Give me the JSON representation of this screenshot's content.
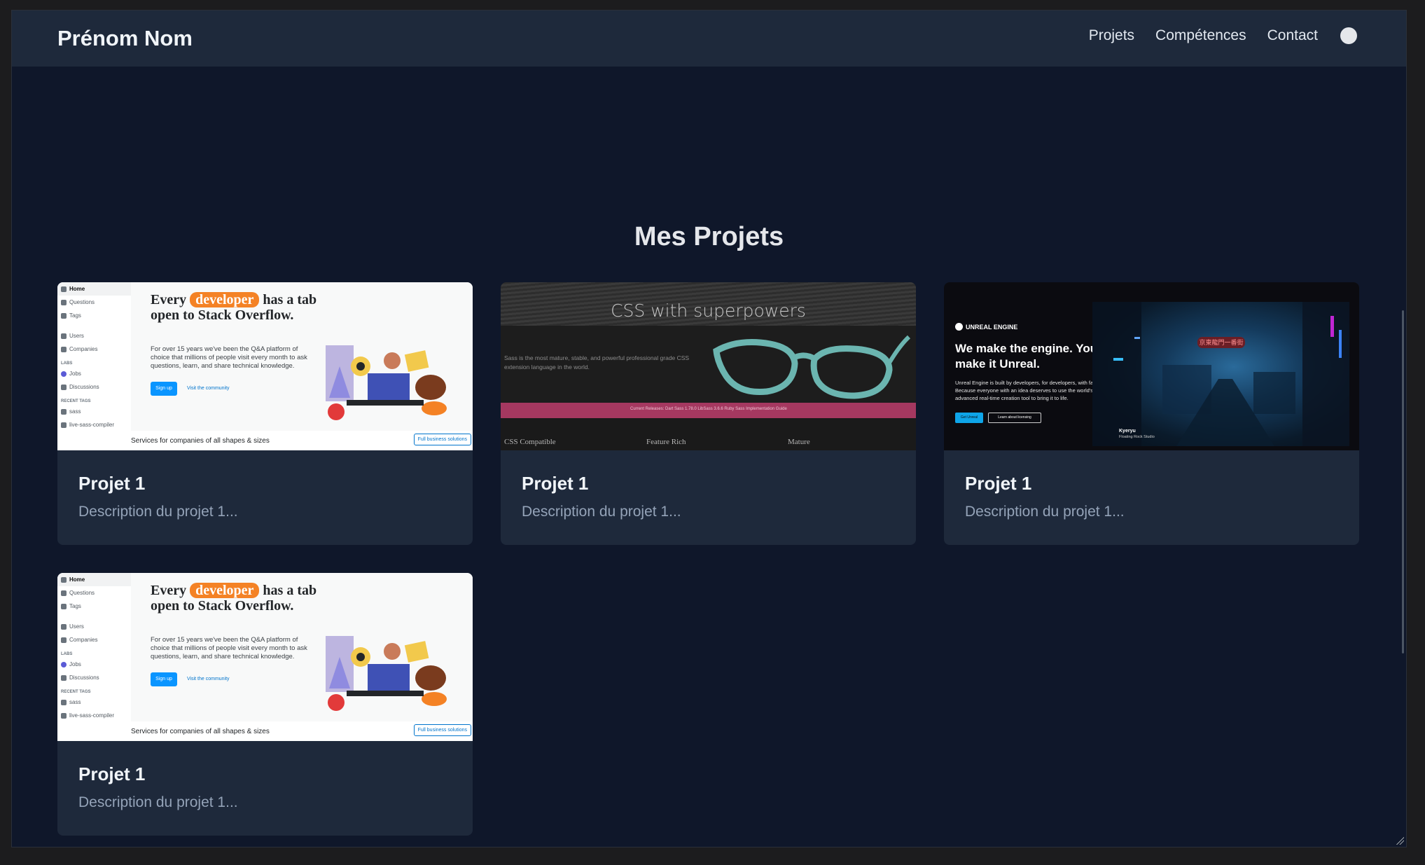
{
  "header": {
    "brand": "Prénom Nom",
    "nav": [
      "Projets",
      "Compétences",
      "Contact"
    ]
  },
  "section": {
    "title": "Mes Projets"
  },
  "projects": [
    {
      "title": "Projet 1",
      "description": "Description du projet 1...",
      "thumbnail": "stackoverflow"
    },
    {
      "title": "Projet 1",
      "description": "Description du projet 1...",
      "thumbnail": "sass"
    },
    {
      "title": "Projet 1",
      "description": "Description du projet 1...",
      "thumbnail": "unreal"
    },
    {
      "title": "Projet 1",
      "description": "Description du projet 1...",
      "thumbnail": "stackoverflow"
    }
  ],
  "thumbs": {
    "so": {
      "sidebar": [
        "Home",
        "Questions",
        "Tags",
        "Users",
        "Companies",
        "LABS",
        "Jobs",
        "Discussions",
        "RECENT TAGS",
        "sass",
        "live-sass-compiler"
      ],
      "headline_pre": "Every",
      "headline_tag": "developer",
      "headline_post": "has a tab open to Stack Overflow.",
      "body": "For over 15 years we've been the Q&A platform of choice that millions of people visit every month to ask questions, learn, and share technical knowledge.",
      "signup": "Sign up",
      "visit": "Visit the community",
      "footer": "Services for companies of all shapes & sizes",
      "footer_btn": "Full business solutions"
    },
    "sass": {
      "title": "CSS with superpowers",
      "body": "Sass is the most mature, stable, and powerful professional grade CSS extension language in the world.",
      "band": "Current Releases:   Dart Sass 1.78.0   LibSass 3.6.6   Ruby Sass      Implementation Guide",
      "cols": [
        "CSS Compatible",
        "Feature Rich",
        "Mature"
      ]
    },
    "ue": {
      "logo": "UNREAL ENGINE",
      "headline": "We make the engine. You make it Unreal.",
      "body": "Unreal Engine is built by developers, for developers, with fair terms for all. Because everyone with an idea deserves to use the world's most open, advanced real-time creation tool to bring it to life.",
      "btn1": "Get Unreal",
      "btn2": "Learn about licensing",
      "sign": "京東龍門一番街",
      "credit": "Kyeryu",
      "credit_sub": "Floating Rock Studio"
    }
  },
  "colors": {
    "background": "#0f172a",
    "surface": "#1e293b",
    "text": "#f1f5f9",
    "muted": "#94a3b8"
  }
}
